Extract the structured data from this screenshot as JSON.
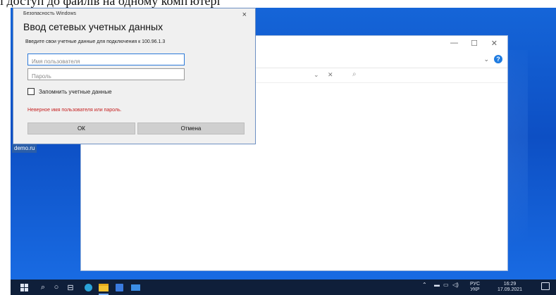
{
  "caption": {
    "text": "і доступ до файлів на одному комп'ютері"
  },
  "dialog": {
    "security_label": "Безопасность Windows",
    "close_glyph": "×",
    "title": "Ввод сетевых учетных данных",
    "prompt": "Введите свои учетные данные для подключения к 100.96.1.3",
    "username": {
      "placeholder": "Имя пользователя",
      "value": ""
    },
    "password": {
      "placeholder": "Пароль",
      "value": ""
    },
    "remember_label": "Запомнить учетные данные",
    "remember_checked": false,
    "error_text": "Неверное имя пользователя или пароль.",
    "ok_label": "ОК",
    "cancel_label": "Отмена"
  },
  "explorer": {
    "minimize": "—",
    "maximize": "☐",
    "close": "✕",
    "chevron": "⌄",
    "help": "?",
    "address_dropdown": "⌄",
    "address_clear": "✕",
    "search_glyph": "⌕"
  },
  "desktop": {
    "icon_label": "demo.ru"
  },
  "taskbar": {
    "language_top": "РУС",
    "language_bottom": "УКР",
    "time": "16:29",
    "date": "17.09.2021",
    "icons": [
      "windows-start-icon",
      "search-icon",
      "cortana-icon",
      "task-view-icon",
      "edge-icon",
      "file-explorer-icon",
      "store-icon",
      "mail-icon"
    ]
  },
  "colors": {
    "desktop": "#1565d8",
    "error": "#c62222",
    "taskbar": "#0f1f3a",
    "accent": "#2b79d8"
  }
}
